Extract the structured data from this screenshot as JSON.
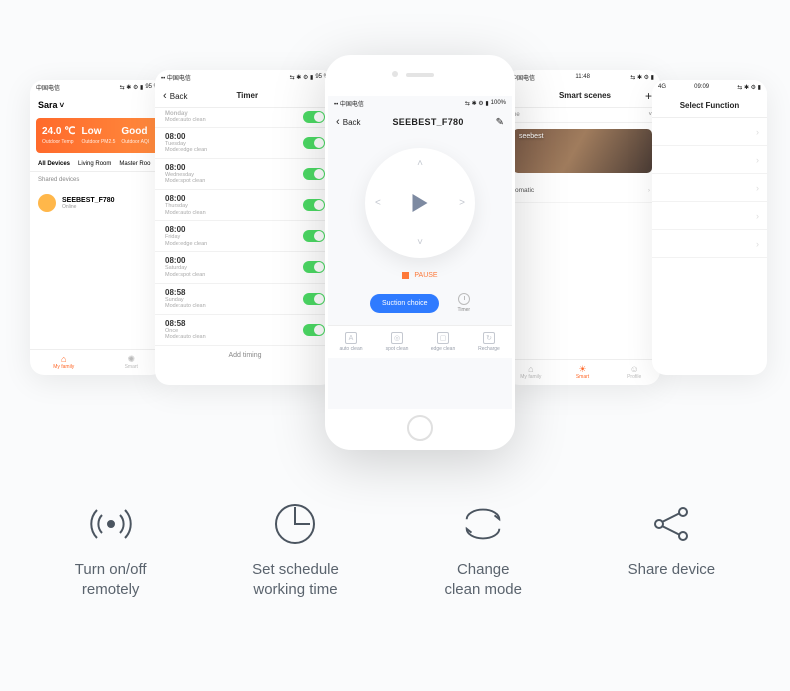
{
  "status": {
    "carrier": "中国电信",
    "time_1": "09:09",
    "time_2": "11:48",
    "battery": "95 %",
    "icons": "⇆ ✱ ⚙ ▮"
  },
  "p1": {
    "user": "Sara",
    "weather": {
      "temp": "24.0 ℃",
      "temp_label": "Outdoor Temp",
      "pm": "Low",
      "pm_label": "Outdoor PM2.5",
      "aqi": "Good",
      "aqi_label": "Outdoor AQI"
    },
    "tabs": [
      "All Devices",
      "Living Room",
      "Master Roo"
    ],
    "shared_label": "Shared devices",
    "device": {
      "name": "SEEBEST_F780",
      "status": "Online"
    },
    "bottom": [
      "My family",
      "Smart"
    ]
  },
  "p2": {
    "back": "Back",
    "title": "Timer",
    "rows": [
      {
        "time": "Monday",
        "sub": "Mode:auto clean",
        "first": true
      },
      {
        "time": "08:00",
        "sub": "Tuesday\nMode:edge clean"
      },
      {
        "time": "08:00",
        "sub": "Wednesday\nMode:spot clean"
      },
      {
        "time": "08:00",
        "sub": "Thursday\nMode:auto clean"
      },
      {
        "time": "08:00",
        "sub": "Friday\nMode:edge clean"
      },
      {
        "time": "08:00",
        "sub": "Saturday\nMode:spot clean"
      },
      {
        "time": "08:58",
        "sub": "Sunday\nMode:auto clean"
      },
      {
        "time": "08:58",
        "sub": "Once\nMode:auto clean"
      }
    ],
    "add": "Add timing"
  },
  "p3": {
    "back": "Back",
    "title": "SEEBEST_F780",
    "pause": "PAUSE",
    "suction": "Suction choice",
    "timer": "Timer",
    "modes": [
      "auto clean",
      "spot clean",
      "edge clean",
      "Recharge"
    ],
    "mode_glyphs": [
      "A",
      "◎",
      "▢",
      "↻"
    ]
  },
  "p4": {
    "title": "Smart scenes",
    "section_scene": "ne",
    "scene_card": "seebest",
    "section_auto": "omatic",
    "bottom": [
      "My family",
      "Smart",
      "Profile"
    ]
  },
  "p5": {
    "title": "Select Function"
  },
  "features": [
    "Turn on/off\nremotely",
    "Set schedule\nworking time",
    "Change\nclean mode",
    "Share device"
  ]
}
